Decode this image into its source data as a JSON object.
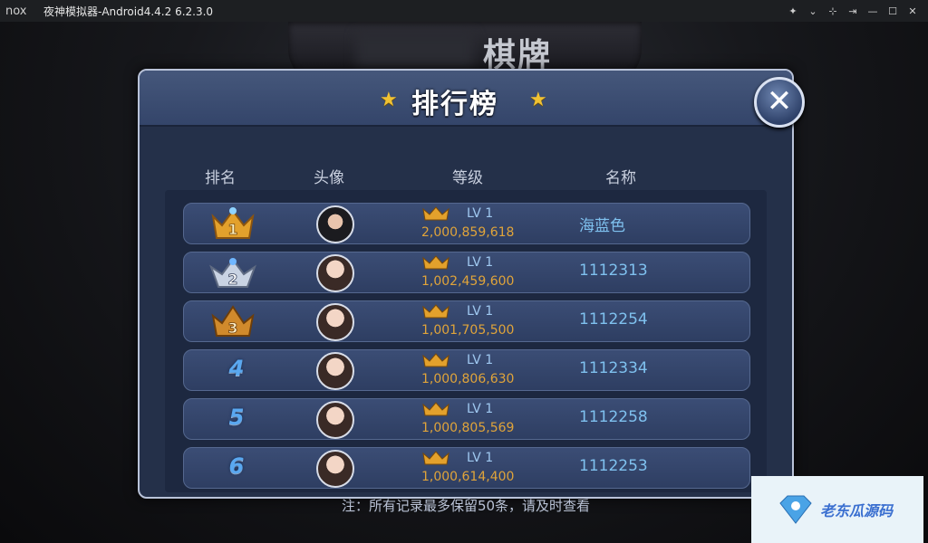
{
  "window": {
    "logo": "nox",
    "title": "夜神模拟器-Android4.4.2 6.2.3.0"
  },
  "background": {
    "banner_text": "棋牌"
  },
  "panel": {
    "title": "排行榜",
    "columns": [
      "排名",
      "头像",
      "等级",
      "名称"
    ],
    "notice": "注：所有记录最多保留50条，请及时查看",
    "rows": [
      {
        "rank": "1",
        "rank_style": "gold-crown",
        "avatar": "male",
        "level": "LV 1",
        "coins": "2,000,859,618",
        "name": "海蓝色"
      },
      {
        "rank": "2",
        "rank_style": "silver-crown",
        "avatar": "female",
        "level": "LV 1",
        "coins": "1,002,459,600",
        "name": "1112313"
      },
      {
        "rank": "3",
        "rank_style": "bronze-crown",
        "avatar": "female",
        "level": "LV 1",
        "coins": "1,001,705,500",
        "name": "1112254"
      },
      {
        "rank": "4",
        "rank_style": "number",
        "avatar": "female",
        "level": "LV 1",
        "coins": "1,000,806,630",
        "name": "1112334"
      },
      {
        "rank": "5",
        "rank_style": "number",
        "avatar": "female",
        "level": "LV 1",
        "coins": "1,000,805,569",
        "name": "1112258"
      },
      {
        "rank": "6",
        "rank_style": "number",
        "avatar": "female",
        "level": "LV 1",
        "coins": "1,000,614,400",
        "name": "1112253"
      }
    ]
  },
  "watermark": {
    "text": "老东瓜源码"
  },
  "colors": {
    "panel_bg": "#243049",
    "name_text": "#7fc1ef",
    "coins_text": "#e0a43a",
    "accent_gold": "#f1c232"
  }
}
